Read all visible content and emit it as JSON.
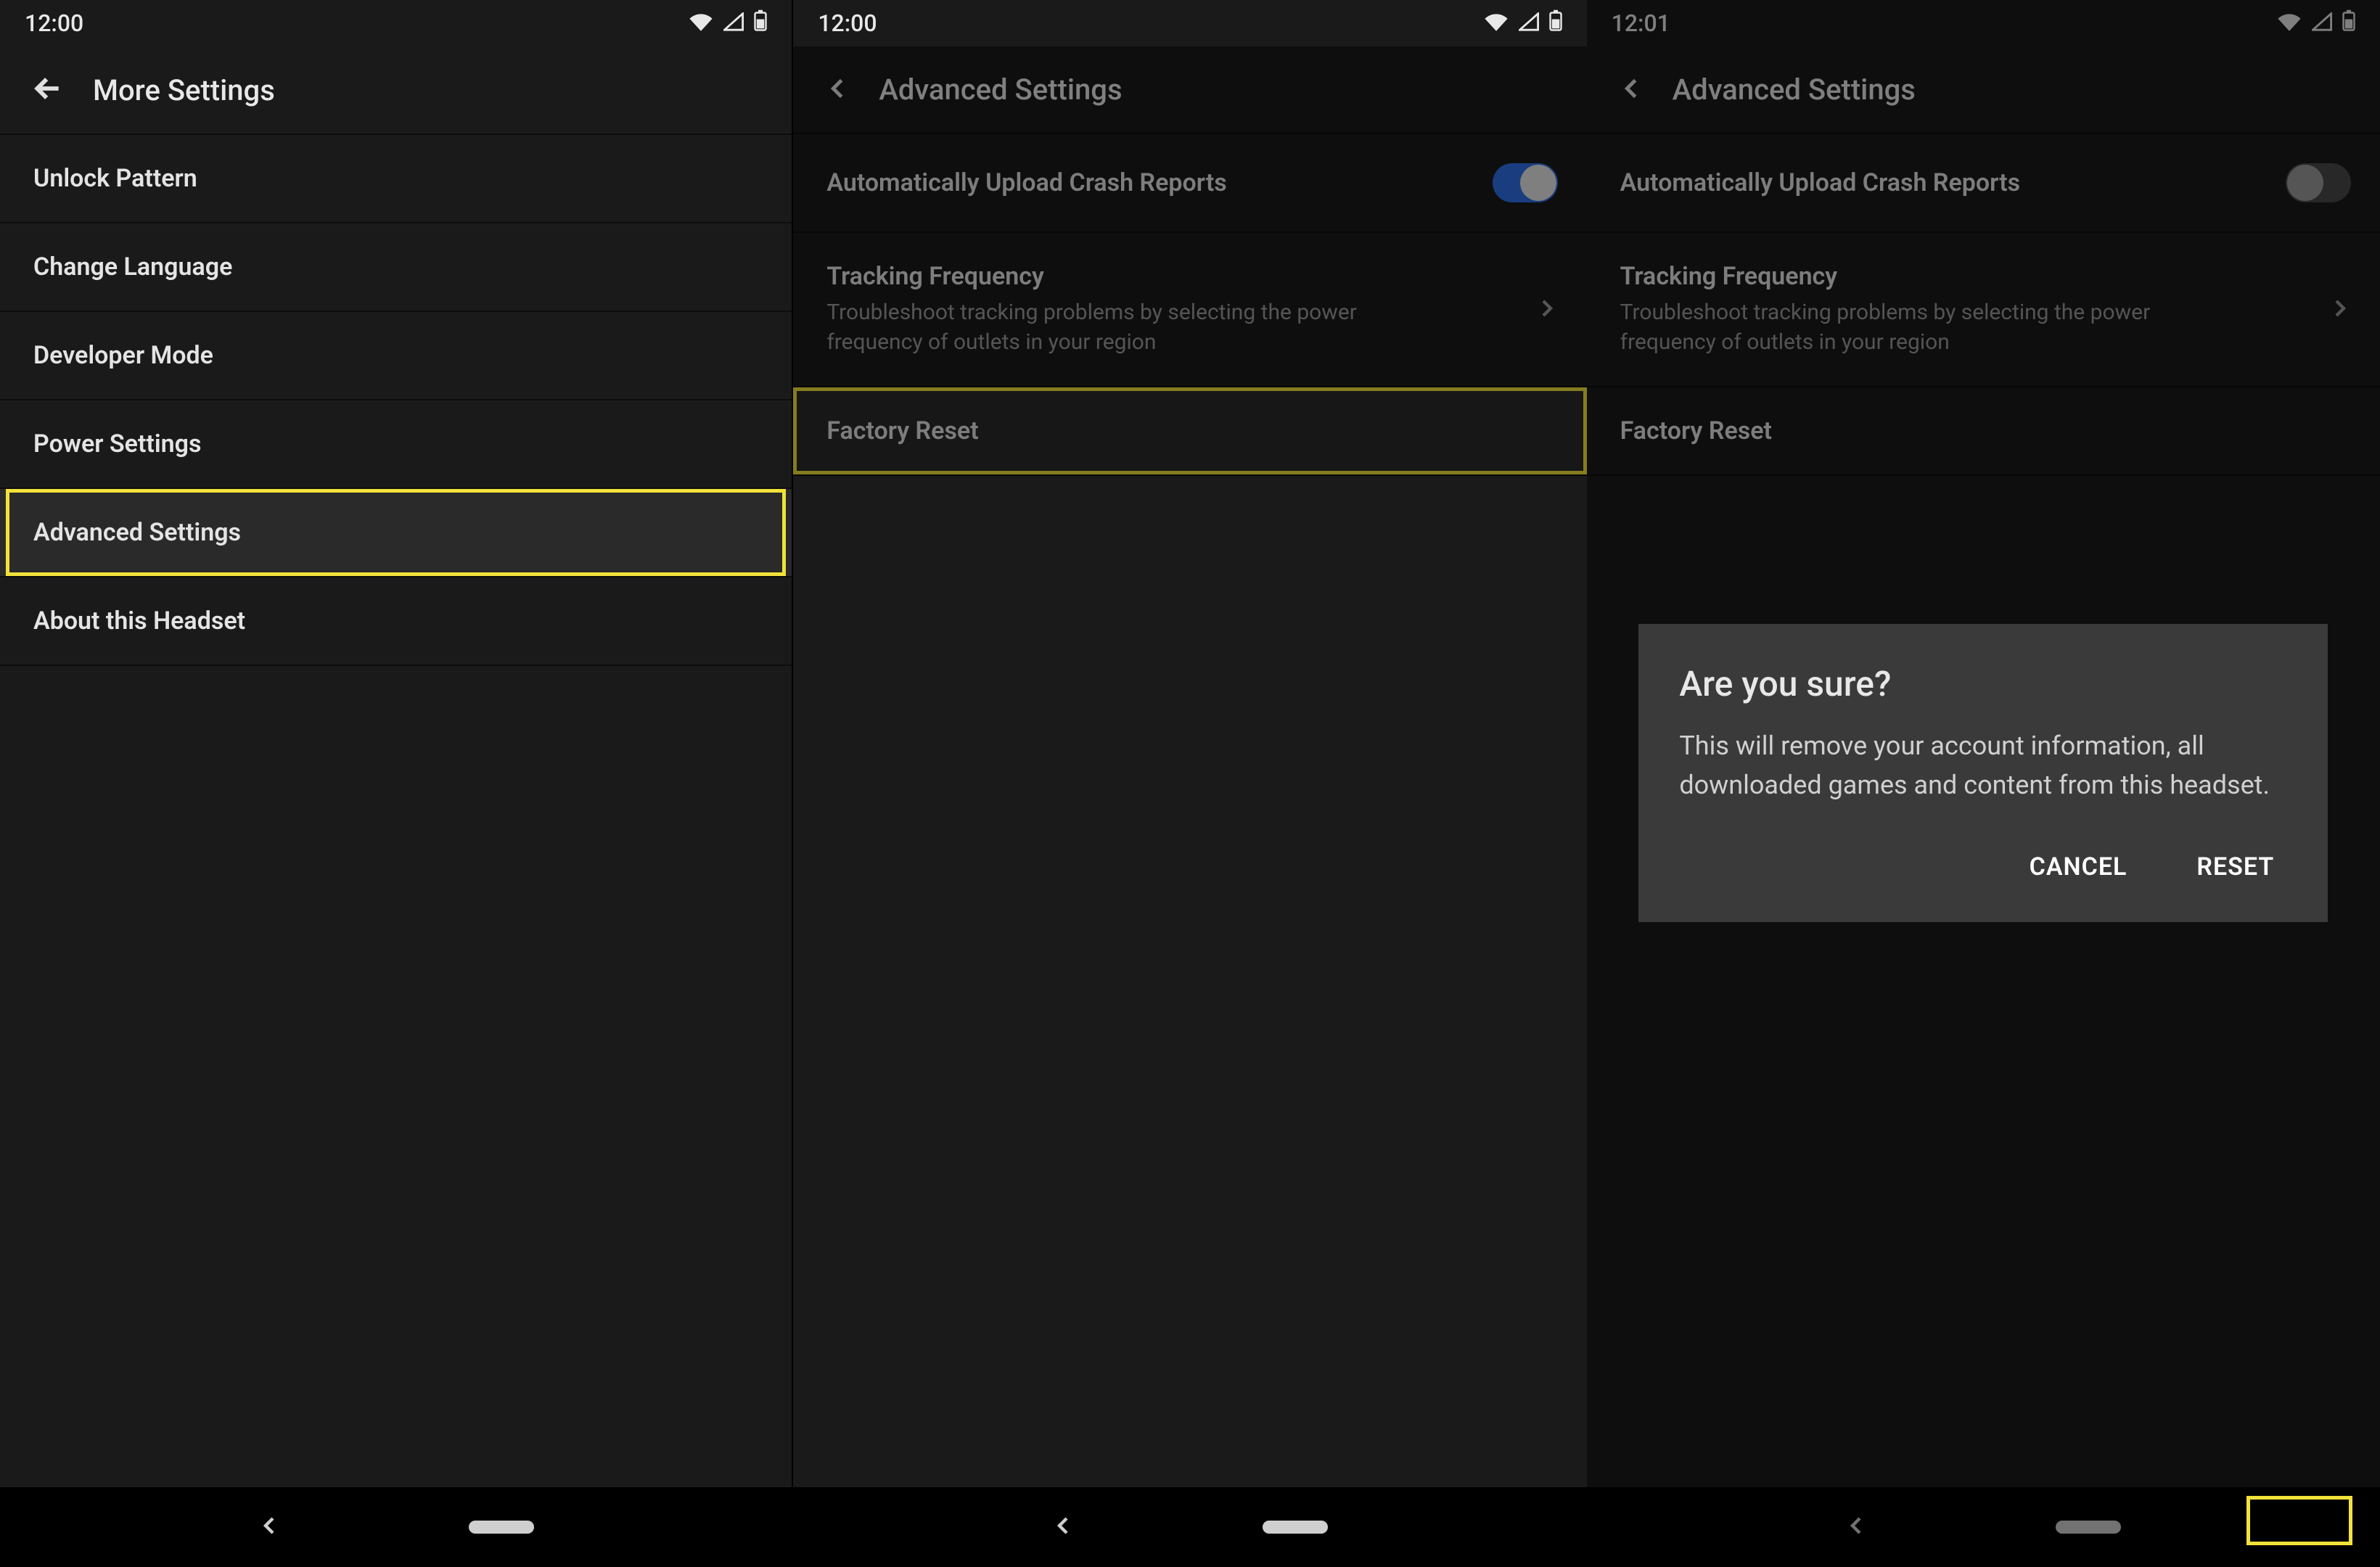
{
  "screens": [
    {
      "time": "12:00",
      "title": "More Settings",
      "items": [
        {
          "label": "Unlock Pattern"
        },
        {
          "label": "Change Language"
        },
        {
          "label": "Developer Mode"
        },
        {
          "label": "Power Settings"
        },
        {
          "label": "Advanced Settings",
          "highlight": true
        },
        {
          "label": "About this Headset"
        }
      ]
    },
    {
      "time": "12:00",
      "title": "Advanced Settings",
      "crash": {
        "label": "Automatically Upload Crash Reports",
        "on": true
      },
      "tracking": {
        "label": "Tracking Frequency",
        "desc": "Troubleshoot tracking problems by selecting the power frequency of outlets in your region"
      },
      "factory": {
        "label": "Factory Reset",
        "highlight": true
      }
    },
    {
      "time": "12:01",
      "title": "Advanced Settings",
      "crash": {
        "label": "Automatically Upload Crash Reports"
      },
      "tracking": {
        "label": "Tracking Frequency",
        "desc": "Troubleshoot tracking problems by selecting the power frequency of outlets in your region"
      },
      "factory": {
        "label": "Factory Reset"
      },
      "dialog": {
        "title": "Are you sure?",
        "body": "This will remove your account information, all downloaded games and content from this headset.",
        "cancel": "CANCEL",
        "confirm": "RESET"
      }
    }
  ]
}
